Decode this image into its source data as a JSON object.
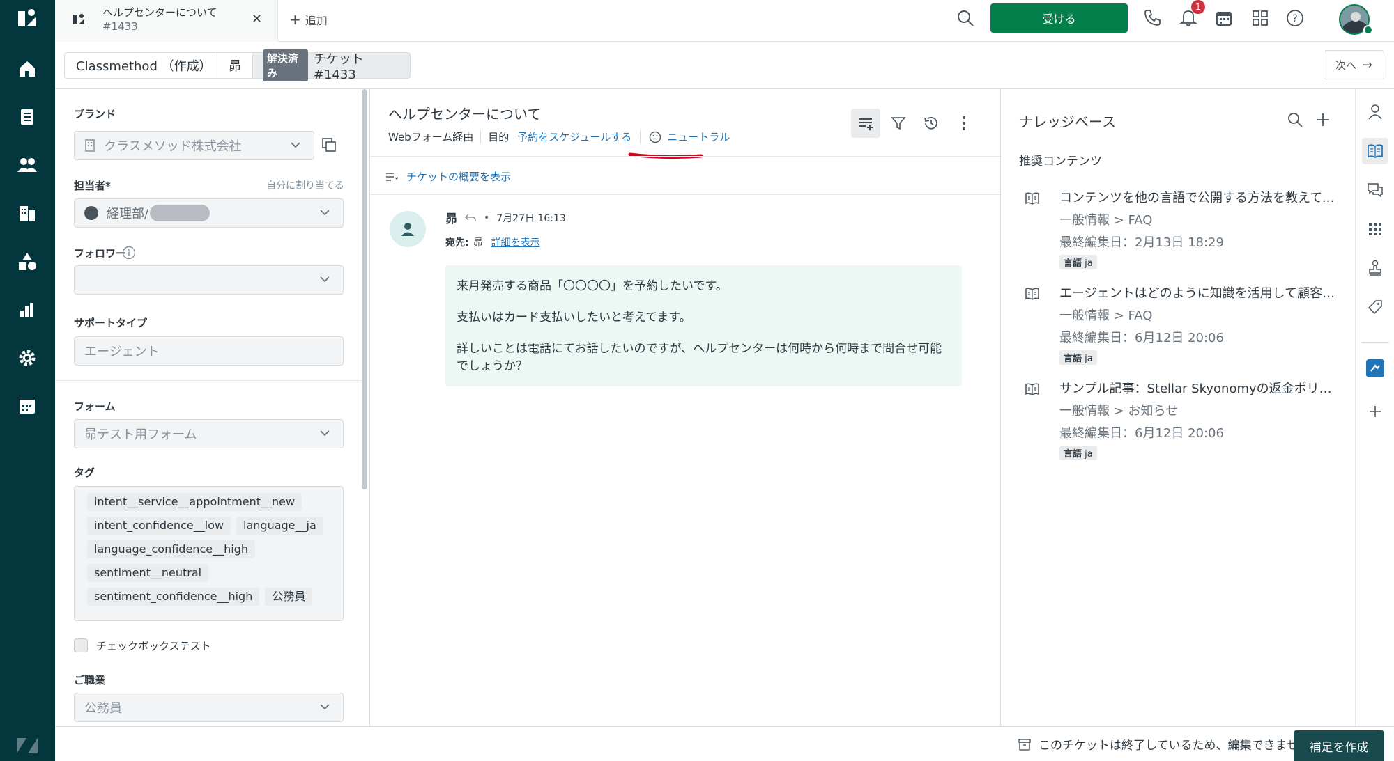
{
  "topbar": {
    "tab_title": "ヘルプセンターについて",
    "tab_id": "#1433",
    "add_label": "追加",
    "accept_button": "受ける",
    "notification_count": "1"
  },
  "breadcrumb": {
    "org": "Classmethod （作成）",
    "user": "昴",
    "status": "解決済み",
    "ticket": "チケット #1433",
    "next": "次へ"
  },
  "left": {
    "brand_label": "ブランド",
    "brand_value": "クラスメソッド株式会社",
    "assignee_label": "担当者*",
    "assign_self": "自分に割り当てる",
    "assignee_value": "経理部/",
    "follower_label": "フォロワー",
    "support_type_label": "サポートタイプ",
    "support_type_value": "エージェント",
    "form_label": "フォーム",
    "form_value": "昴テスト用フォーム",
    "tags_label": "タグ",
    "tags": [
      "intent__service__appointment__new",
      "intent_confidence__low",
      "language__ja",
      "language_confidence__high",
      "sentiment__neutral",
      "sentiment_confidence__high",
      "公務員"
    ],
    "checkbox_label": "チェックボックステスト",
    "job_label": "ご職業",
    "job_value": "公務員"
  },
  "center": {
    "title": "ヘルプセンターについて",
    "via": "Webフォーム経由",
    "purpose_label": "目的",
    "purpose_value": "予約をスケジュールする",
    "sentiment": "ニュートラル",
    "summary_link": "チケットの概要を表示",
    "sender": "昴",
    "timestamp": "7月27日 16:13",
    "to_label": "宛先:",
    "to_value": "昴",
    "details_link": "詳細を表示",
    "message_lines": [
      "来月発売する商品「〇〇〇〇」を予約したいです。",
      "支払いはカード支払いしたいと考えてます。",
      "詳しいことは電話にてお話したいのですが、ヘルプセンターは何時から何時まで問合せ可能でしょうか？"
    ]
  },
  "knowledge": {
    "title": "ナレッジベース",
    "recommended": "推奨コンテンツ",
    "lang_label": "言語",
    "lang_value": "ja",
    "articles": [
      {
        "title": "コンテンツを他の言語で公開する方法を教えてください...",
        "path": "一般情報 > FAQ",
        "edited": "最終編集日：2月13日 18:29"
      },
      {
        "title": "エージェントはどのように知識を活用して顧客を支援で...",
        "path": "一般情報 > FAQ",
        "edited": "最終編集日：6月12日 20:06"
      },
      {
        "title": "サンプル記事：Stellar Skyonomyの返金ポリシー",
        "path": "一般情報 > お知らせ",
        "edited": "最終編集日：6月12日 20:06"
      }
    ]
  },
  "footer": {
    "closed_notice": "このチケットは終了しているため、編集できません",
    "followup_button": "補足を作成"
  },
  "colors": {
    "nav_bg": "#03363d",
    "accept_green": "#037f4c",
    "link_blue": "#1f73b7",
    "annotation_red": "#e0001b"
  }
}
